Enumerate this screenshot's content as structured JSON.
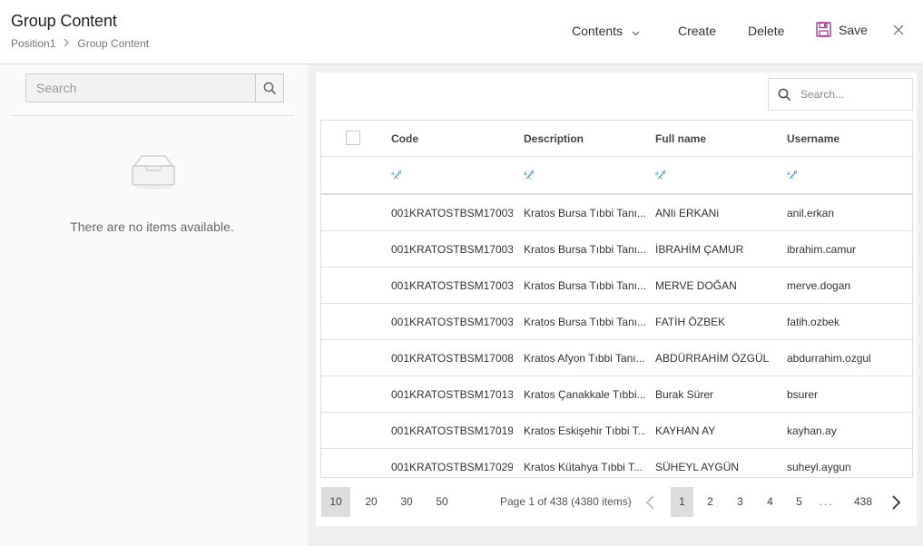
{
  "header": {
    "title": "Group Content",
    "breadcrumb": [
      "Position1",
      "Group Content"
    ]
  },
  "toolbar": {
    "contents": "Contents",
    "create": "Create",
    "delete": "Delete",
    "save": "Save"
  },
  "left": {
    "search_placeholder": "Search",
    "empty_text": "There are no items available."
  },
  "grid": {
    "search_placeholder": "Search...",
    "columns": [
      "Code",
      "Description",
      "Full name",
      "Username"
    ],
    "rows": [
      {
        "code": "001KRATOSTBSM17003...",
        "description": "Kratos Bursa Tıbbi Tanı...",
        "full_name": "ANIi ERKANi",
        "username": "anil.erkan"
      },
      {
        "code": "001KRATOSTBSM17003...",
        "description": "Kratos Bursa Tıbbi Tanı...",
        "full_name": "İBRAHİM ÇAMUR",
        "username": "ibrahim.camur"
      },
      {
        "code": "001KRATOSTBSM17003...",
        "description": "Kratos Bursa Tıbbi Tanı...",
        "full_name": "MERVE DOĞAN",
        "username": "merve.dogan"
      },
      {
        "code": "001KRATOSTBSM17003...",
        "description": "Kratos Bursa Tıbbi Tanı...",
        "full_name": "FATİH ÖZBEK",
        "username": "fatih.ozbek"
      },
      {
        "code": "001KRATOSTBSM17008...",
        "description": "Kratos Afyon Tıbbi Tanı...",
        "full_name": "ABDÜRRAHİM ÖZGÜL",
        "username": "abdurrahim.ozgul"
      },
      {
        "code": "001KRATOSTBSM17013...",
        "description": "Kratos Çanakkale Tıbbi...",
        "full_name": "Burak Sürer",
        "username": "bsurer"
      },
      {
        "code": "001KRATOSTBSM17019...",
        "description": "Kratos Eskişehir Tıbbi T...",
        "full_name": "KAYHAN AY",
        "username": "kayhan.ay"
      },
      {
        "code": "001KRATOSTBSM17029...",
        "description": "Kratos Kütahya Tıbbi T...",
        "full_name": "SÜHEYL AYGÜN",
        "username": "suheyl.aygun"
      }
    ]
  },
  "pager": {
    "page_sizes": [
      "10",
      "20",
      "30",
      "50"
    ],
    "selected_size": "10",
    "info": "Page 1 of 438 (4380 items)",
    "pages": [
      "1",
      "2",
      "3",
      "4",
      "5",
      "...",
      "438"
    ],
    "current_page": "1"
  },
  "colors": {
    "accent_purple": "#a0388f",
    "filter_icon_blue": "#2e86c1"
  }
}
